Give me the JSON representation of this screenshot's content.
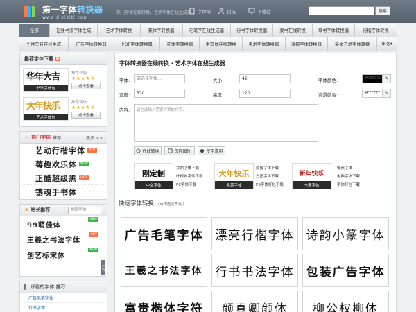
{
  "header": {
    "logo_title_a": "第一字体",
    "logo_title_b": "转换器",
    "logo_sub": "www.diyiziti.com",
    "slogan": "热门字体在线转换，艺术字体在线生成器",
    "links": [
      "字体库",
      "论坛",
      "下载站"
    ],
    "search_button": "搜索",
    "brand_color": "#6d7884"
  },
  "nav": {
    "row1": [
      "全部",
      "在线书法字体生成",
      "艺术字体转换",
      "篆体字转换器",
      "毛笔字在线生成器",
      "行书字体转换器",
      "隶书在线转换",
      "草书字体转换器",
      "行楷字体转换"
    ],
    "row2": [
      "个性签名在线生成",
      "广告字体转换器",
      "POP字体转换器",
      "花体字转换器",
      "手写体在线转换",
      "美术字体转换器",
      "海报字体转换器",
      "英文艺术字体转换",
      "更多"
    ],
    "active_index": 0
  },
  "sidebar": {
    "recommend": {
      "title": "推荐字体下载",
      "items": [
        {
          "image_text": "华年大吉",
          "caption": "书法字体包",
          "rating_label": "推荐评级:",
          "stars": "★★★★★",
          "button": "点击查看"
        },
        {
          "image_text": "大年快乐",
          "caption": "艺术字体包",
          "rating_label": "推荐评级:",
          "stars": "★★★★★",
          "button": "点击查看"
        }
      ]
    },
    "hot": {
      "title": "热门字体",
      "subtitle": "推荐",
      "more": "更多 >>",
      "items": [
        {
          "text": "艺动行楷字体",
          "badge": "HOT"
        },
        {
          "text": "莓趣欢乐体",
          "badge": "NEW"
        },
        {
          "text": "正酷超级黑",
          "badge": "HOT"
        },
        {
          "text": "镌魂手书体",
          "badge": ""
        }
      ]
    },
    "site": {
      "title": "站长推荐",
      "search_placeholder": "恢图字体",
      "items": [
        {
          "text": "99萌佳体",
          "badge": "NEW"
        },
        {
          "text": "王羲之书法字体",
          "badge": "HOT"
        },
        {
          "text": "创艺标宋体",
          "badge": "NEW"
        }
      ],
      "side_tag": "广告"
    },
    "good": {
      "title": "好看的字体 推荐",
      "items": [
        "广告毛笔字体",
        "行书字体"
      ]
    }
  },
  "main": {
    "title": "字体转换器在线转换 · 艺术字体在线生成器",
    "form": {
      "font_label": "字体:",
      "font_placeholder": "请选择字体...",
      "size_label": "大小:",
      "size_value": "42",
      "font_color_label": "字体颜色:",
      "font_color_value": "#000000",
      "width_label": "宽度:",
      "width_value": "570",
      "height_label": "高度:",
      "height_value": "120",
      "bg_color_label": "背景颜色:",
      "bg_color_value": "#FFFFFF",
      "content_label": "内容:",
      "content_placeholder": "请在此输入需要转换的文字。"
    },
    "actions": [
      "在线转换",
      "保存图片",
      "使用说明"
    ],
    "downloads": [
      {
        "image_text": "刚定制",
        "caption": "中文字体",
        "links": [
          "文鼎字体下载",
          "叶根友字体下载",
          "PC字体下载"
        ]
      },
      {
        "image_text": "大年快乐",
        "caption": "毛笔字体",
        "links": [
          "海报字体下载",
          "方正字体下载",
          "PS字体打包下载"
        ]
      },
      {
        "image_text": "新年快乐",
        "caption": "卡通字体",
        "links": [
          "像素字体",
          "电脑字体下载",
          "字体打包下载"
        ]
      }
    ],
    "quick": {
      "title": "快速字体转换",
      "subtitle": "（点击图片即可）",
      "cards": [
        "广告毛笔字体",
        "漂亮行楷字体",
        "诗韵小篆字体",
        "王羲之书法字体",
        "行书书法字体",
        "包装广告字体",
        "富贵楷体字符",
        "颜真卿颜体",
        "柳公权柳体"
      ]
    }
  }
}
